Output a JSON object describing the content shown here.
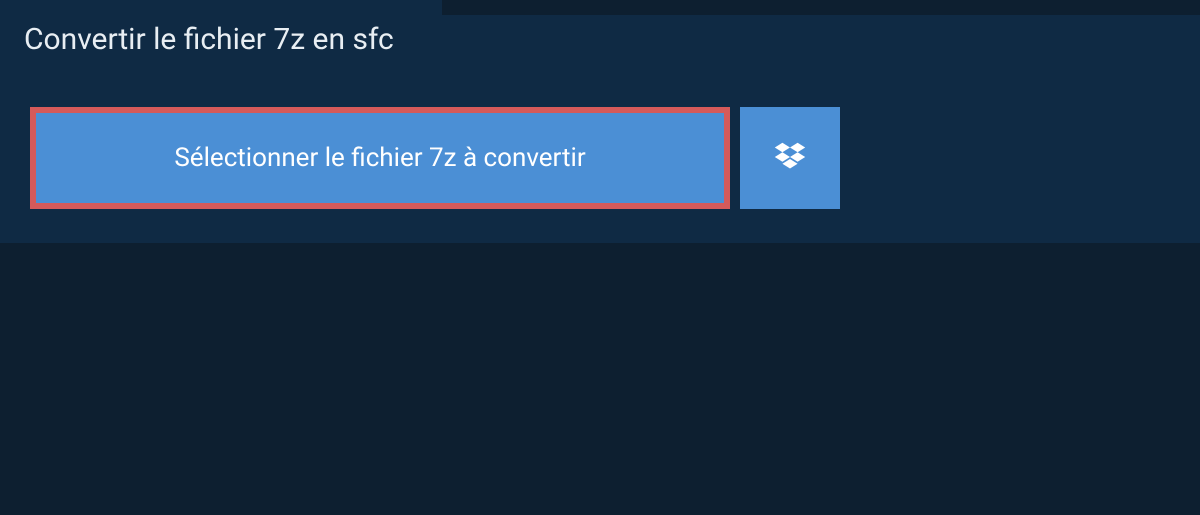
{
  "header": {
    "title": "Convertir le fichier 7z en sfc"
  },
  "actions": {
    "select_file_label": "Sélectionner le fichier 7z à convertir"
  },
  "colors": {
    "page_bg": "#0d1f30",
    "panel_bg": "#0f2a44",
    "button_bg": "#4b8fd5",
    "button_highlight_border": "#d55a5a",
    "text_light": "#ffffff"
  }
}
